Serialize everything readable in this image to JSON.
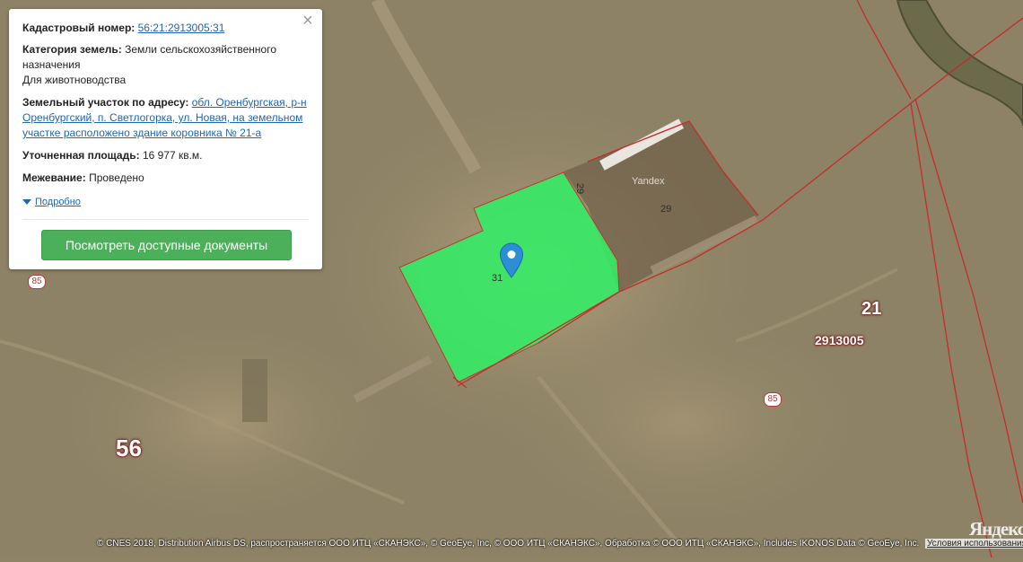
{
  "map": {
    "region_label": "56",
    "district_label": "21",
    "quarter_label": "2913005",
    "road_badges": [
      "85",
      "85"
    ],
    "plot_numbers": {
      "selected": "31",
      "neighbor": "29",
      "neighbor_vertical": "29"
    },
    "imagery_watermark": "Yandex",
    "selected_plot_color": "#33ee66",
    "boundary_color": "#c62b2b",
    "marker_icon": "map-pin-icon",
    "attribution": "© CNES 2018, Distribution Airbus DS, распространяется ООО ИТЦ «СКАНЭКС», © GeoEye, Inc, © ООО ИТЦ «СКАНЭКС», Обработка © ООО ИТЦ «СКАНЭКС», Includes IKONOS Data © GeoEye, Inc.",
    "terms_link": "Условия использования",
    "logo": "Яндекс"
  },
  "card": {
    "cadastral_label": "Кадастровый номер:",
    "cadastral_value": "56:21:2913005:31",
    "category_label": "Категория земель:",
    "category_value": "Земли сельскохозяйственного назначения",
    "category_use": "Для животноводства",
    "address_label": "Земельный участок по адресу:",
    "address_value": "обл. Оренбургская, р-н Оренбургский, п. Светлогорка, ул. Новая, на земельном участке расположено здание коровника № 21-а",
    "area_label": "Уточненная площадь:",
    "area_value": "16 977 кв.м.",
    "survey_label": "Межевание:",
    "survey_value": "Проведено",
    "more_label": "Подробно",
    "button_label": "Посмотреть доступные документы",
    "close_icon": "close-icon"
  }
}
